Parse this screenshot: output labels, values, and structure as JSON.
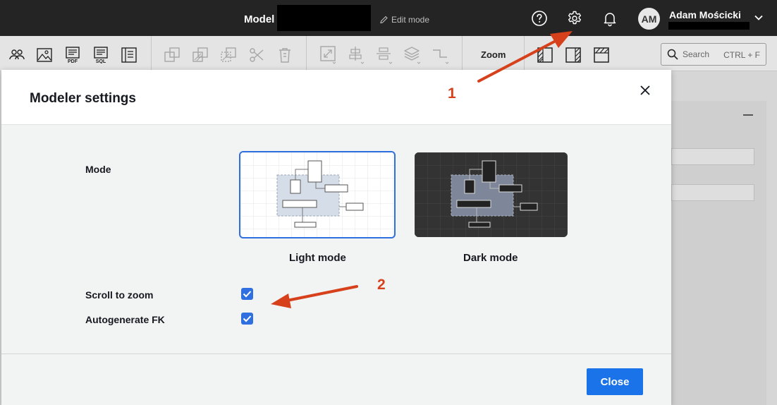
{
  "topbar": {
    "model_label": "Model",
    "edit_mode": "Edit mode",
    "user_initials": "AM",
    "user_name": "Adam Mościcki"
  },
  "toolbar": {
    "zoom_label": "Zoom",
    "search": {
      "placeholder": "Search",
      "shortcut": "CTRL + F"
    },
    "icons": [
      "users-icon",
      "image-icon",
      "pdf-icon",
      "sql-icon",
      "document-icon",
      "copy-icon",
      "duplicate-icon",
      "paste-style-icon",
      "cut-icon",
      "delete-icon",
      "resize-icon",
      "align-center-icon",
      "distribute-icon",
      "layers-icon",
      "line-style-icon",
      "pattern-left-icon",
      "pattern-right-icon",
      "pattern-top-icon"
    ]
  },
  "modal": {
    "title": "Modeler settings",
    "mode_label": "Mode",
    "light_mode_label": "Light mode",
    "dark_mode_label": "Dark mode",
    "selected_mode": "light",
    "scroll_to_zoom_label": "Scroll to zoom",
    "scroll_to_zoom_checked": true,
    "autogenerate_fk_label": "Autogenerate FK",
    "autogenerate_fk_checked": true,
    "close_button": "Close"
  },
  "annotations": {
    "marker_1": "1",
    "marker_2": "2",
    "color": "#d6401b"
  },
  "colors": {
    "accent": "#1a73e8",
    "topbar": "#242424",
    "checkbox": "#2f6fe0"
  }
}
